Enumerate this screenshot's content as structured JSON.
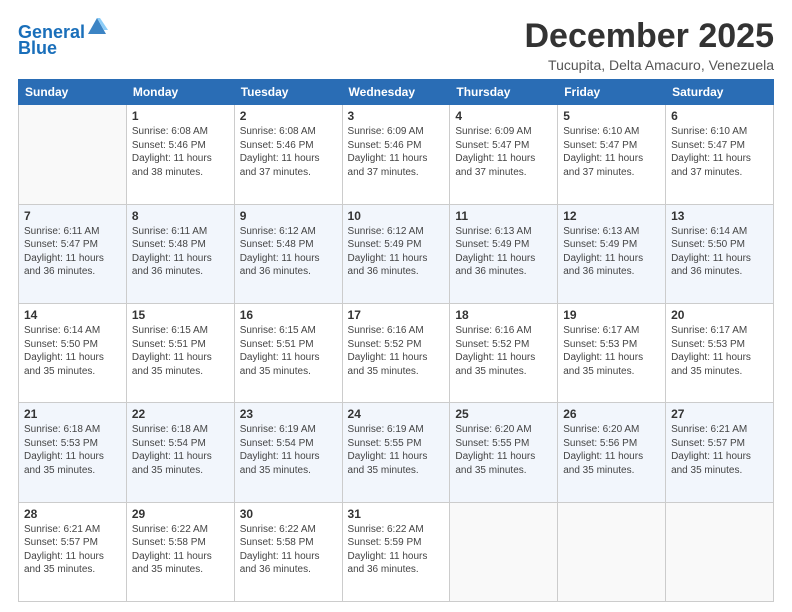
{
  "header": {
    "logo_line1": "General",
    "logo_line2": "Blue",
    "month": "December 2025",
    "location": "Tucupita, Delta Amacuro, Venezuela"
  },
  "days_of_week": [
    "Sunday",
    "Monday",
    "Tuesday",
    "Wednesday",
    "Thursday",
    "Friday",
    "Saturday"
  ],
  "weeks": [
    [
      {
        "day": "",
        "info": ""
      },
      {
        "day": "1",
        "info": "Sunrise: 6:08 AM\nSunset: 5:46 PM\nDaylight: 11 hours\nand 38 minutes."
      },
      {
        "day": "2",
        "info": "Sunrise: 6:08 AM\nSunset: 5:46 PM\nDaylight: 11 hours\nand 37 minutes."
      },
      {
        "day": "3",
        "info": "Sunrise: 6:09 AM\nSunset: 5:46 PM\nDaylight: 11 hours\nand 37 minutes."
      },
      {
        "day": "4",
        "info": "Sunrise: 6:09 AM\nSunset: 5:47 PM\nDaylight: 11 hours\nand 37 minutes."
      },
      {
        "day": "5",
        "info": "Sunrise: 6:10 AM\nSunset: 5:47 PM\nDaylight: 11 hours\nand 37 minutes."
      },
      {
        "day": "6",
        "info": "Sunrise: 6:10 AM\nSunset: 5:47 PM\nDaylight: 11 hours\nand 37 minutes."
      }
    ],
    [
      {
        "day": "7",
        "info": "Sunrise: 6:11 AM\nSunset: 5:47 PM\nDaylight: 11 hours\nand 36 minutes."
      },
      {
        "day": "8",
        "info": "Sunrise: 6:11 AM\nSunset: 5:48 PM\nDaylight: 11 hours\nand 36 minutes."
      },
      {
        "day": "9",
        "info": "Sunrise: 6:12 AM\nSunset: 5:48 PM\nDaylight: 11 hours\nand 36 minutes."
      },
      {
        "day": "10",
        "info": "Sunrise: 6:12 AM\nSunset: 5:49 PM\nDaylight: 11 hours\nand 36 minutes."
      },
      {
        "day": "11",
        "info": "Sunrise: 6:13 AM\nSunset: 5:49 PM\nDaylight: 11 hours\nand 36 minutes."
      },
      {
        "day": "12",
        "info": "Sunrise: 6:13 AM\nSunset: 5:49 PM\nDaylight: 11 hours\nand 36 minutes."
      },
      {
        "day": "13",
        "info": "Sunrise: 6:14 AM\nSunset: 5:50 PM\nDaylight: 11 hours\nand 36 minutes."
      }
    ],
    [
      {
        "day": "14",
        "info": "Sunrise: 6:14 AM\nSunset: 5:50 PM\nDaylight: 11 hours\nand 35 minutes."
      },
      {
        "day": "15",
        "info": "Sunrise: 6:15 AM\nSunset: 5:51 PM\nDaylight: 11 hours\nand 35 minutes."
      },
      {
        "day": "16",
        "info": "Sunrise: 6:15 AM\nSunset: 5:51 PM\nDaylight: 11 hours\nand 35 minutes."
      },
      {
        "day": "17",
        "info": "Sunrise: 6:16 AM\nSunset: 5:52 PM\nDaylight: 11 hours\nand 35 minutes."
      },
      {
        "day": "18",
        "info": "Sunrise: 6:16 AM\nSunset: 5:52 PM\nDaylight: 11 hours\nand 35 minutes."
      },
      {
        "day": "19",
        "info": "Sunrise: 6:17 AM\nSunset: 5:53 PM\nDaylight: 11 hours\nand 35 minutes."
      },
      {
        "day": "20",
        "info": "Sunrise: 6:17 AM\nSunset: 5:53 PM\nDaylight: 11 hours\nand 35 minutes."
      }
    ],
    [
      {
        "day": "21",
        "info": "Sunrise: 6:18 AM\nSunset: 5:53 PM\nDaylight: 11 hours\nand 35 minutes."
      },
      {
        "day": "22",
        "info": "Sunrise: 6:18 AM\nSunset: 5:54 PM\nDaylight: 11 hours\nand 35 minutes."
      },
      {
        "day": "23",
        "info": "Sunrise: 6:19 AM\nSunset: 5:54 PM\nDaylight: 11 hours\nand 35 minutes."
      },
      {
        "day": "24",
        "info": "Sunrise: 6:19 AM\nSunset: 5:55 PM\nDaylight: 11 hours\nand 35 minutes."
      },
      {
        "day": "25",
        "info": "Sunrise: 6:20 AM\nSunset: 5:55 PM\nDaylight: 11 hours\nand 35 minutes."
      },
      {
        "day": "26",
        "info": "Sunrise: 6:20 AM\nSunset: 5:56 PM\nDaylight: 11 hours\nand 35 minutes."
      },
      {
        "day": "27",
        "info": "Sunrise: 6:21 AM\nSunset: 5:57 PM\nDaylight: 11 hours\nand 35 minutes."
      }
    ],
    [
      {
        "day": "28",
        "info": "Sunrise: 6:21 AM\nSunset: 5:57 PM\nDaylight: 11 hours\nand 35 minutes."
      },
      {
        "day": "29",
        "info": "Sunrise: 6:22 AM\nSunset: 5:58 PM\nDaylight: 11 hours\nand 35 minutes."
      },
      {
        "day": "30",
        "info": "Sunrise: 6:22 AM\nSunset: 5:58 PM\nDaylight: 11 hours\nand 36 minutes."
      },
      {
        "day": "31",
        "info": "Sunrise: 6:22 AM\nSunset: 5:59 PM\nDaylight: 11 hours\nand 36 minutes."
      },
      {
        "day": "",
        "info": ""
      },
      {
        "day": "",
        "info": ""
      },
      {
        "day": "",
        "info": ""
      }
    ]
  ]
}
